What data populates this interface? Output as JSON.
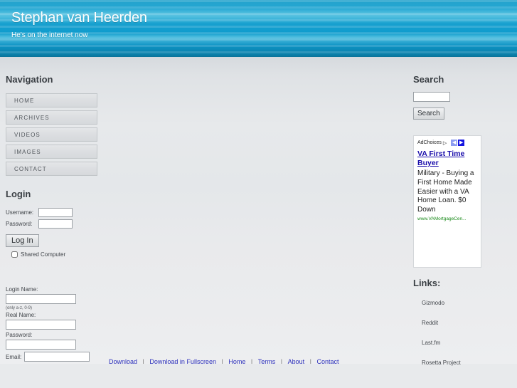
{
  "header": {
    "title": "Stephan van Heerden",
    "tagline": "He's on the internet now"
  },
  "sidebar_left": {
    "navigation": {
      "heading": "Navigation",
      "items": [
        {
          "label": "HOME"
        },
        {
          "label": "ARCHIVES"
        },
        {
          "label": "VIDEOS"
        },
        {
          "label": "IMAGES"
        },
        {
          "label": "CONTACT"
        }
      ]
    },
    "login": {
      "heading": "Login",
      "username_label": "Username:",
      "username_value": "",
      "password_label": "Password:",
      "password_value": "",
      "submit_label": "Log In",
      "shared_computer_label": "Shared Computer",
      "shared_computer_checked": false
    },
    "register": {
      "login_name_label": "Login Name:",
      "login_name_value": "",
      "login_name_hint": "(only a-z, 0-9)",
      "real_name_label": "Real Name:",
      "real_name_value": "",
      "password_label": "Password:",
      "password_value": "",
      "email_label": "Email:",
      "email_value": ""
    }
  },
  "sidebar_right": {
    "search": {
      "heading": "Search",
      "input_value": "",
      "button_label": "Search"
    },
    "ad": {
      "adchoices_label": "AdChoices",
      "adchoices_glyph": "▷",
      "prev_glyph": "◀",
      "next_glyph": "▶",
      "title": "VA First Time Buyer",
      "body": "Military - Buying a First Home Made Easier with a VA Home Loan. $0 Down",
      "url": "www.VAMortgageCen..."
    },
    "links": {
      "heading": "Links:",
      "items": [
        {
          "label": "Gizmodo"
        },
        {
          "label": "Reddit"
        },
        {
          "label": "Last.fm"
        },
        {
          "label": "Rosetta Project"
        }
      ]
    }
  },
  "footer": {
    "items": [
      {
        "label": "Download"
      },
      {
        "label": "Download in Fullscreen"
      },
      {
        "label": "Home"
      },
      {
        "label": "Terms"
      },
      {
        "label": "About"
      },
      {
        "label": "Contact"
      }
    ],
    "separator": "|"
  },
  "colors": {
    "header_blue": "#17a0cf",
    "body_grey": "#e7e9eb",
    "ad_link_blue": "#1a0dab",
    "ad_url_green": "#1a8a1a",
    "link_blue": "#2b2fbb"
  }
}
